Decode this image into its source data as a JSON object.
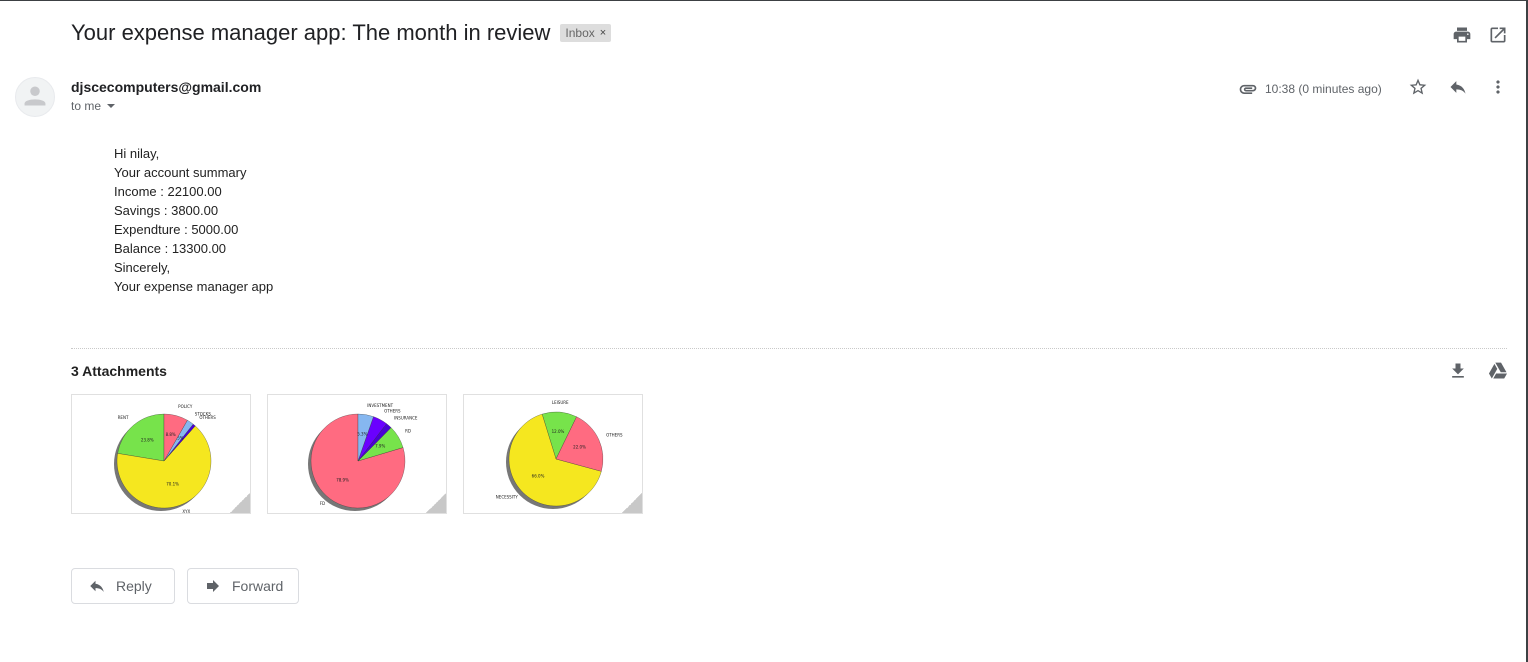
{
  "email": {
    "subject": "Your expense manager app: The month in review",
    "label": "Inbox",
    "label_remove": "×",
    "sender": "djscecomputers@gmail.com",
    "recipient_line": "to me",
    "time": "10:38 (0 minutes ago)",
    "body_lines": [
      "Hi nilay,",
      "Your account summary",
      "Income : 22100.00",
      "Savings : 3800.00",
      "Expendture : 5000.00",
      "Balance : 13300.00",
      "Sincerely,",
      "Your expense manager app"
    ]
  },
  "attachments": {
    "title": "3 Attachments",
    "items": [
      {
        "slices": [
          {
            "label": "RENT",
            "pct": "23.8%",
            "value": 23.8,
            "color": "#77e34b"
          },
          {
            "label": "XYX",
            "pct": "70.1%",
            "value": 70.1,
            "color": "#f5e71f"
          },
          {
            "label": "OTHERS",
            "pct": "",
            "value": 1.0,
            "color": "#4a00d6"
          },
          {
            "label": "STOCKS",
            "pct": "2.5%",
            "value": 2.5,
            "color": "#86b7f0"
          },
          {
            "label": "POLICY",
            "pct": "8.8%",
            "value": 8.8,
            "color": "#ff6b81"
          }
        ]
      },
      {
        "slices": [
          {
            "label": "FD",
            "pct": "78.9%",
            "value": 78.9,
            "color": "#ff6b81"
          },
          {
            "label": "RD",
            "pct": "7.9%",
            "value": 7.9,
            "color": "#77e34b"
          },
          {
            "label": "INSURANCE",
            "pct": "",
            "value": 2.0,
            "color": "#4a00d6"
          },
          {
            "label": "OTHERS",
            "pct": "",
            "value": 5.0,
            "color": "#6a00ff"
          },
          {
            "label": "INVESTMENT",
            "pct": "5.3%",
            "value": 5.3,
            "color": "#86b7f0"
          }
        ]
      },
      {
        "slices": [
          {
            "label": "LEISURE",
            "pct": "12.0%",
            "value": 12.0,
            "color": "#77e34b"
          },
          {
            "label": "NECESSITY",
            "pct": "66.0%",
            "value": 66.0,
            "color": "#f5e71f"
          },
          {
            "label": "OTHERS",
            "pct": "22.0%",
            "value": 22.0,
            "color": "#ff6b81"
          }
        ]
      }
    ]
  },
  "actions": {
    "reply": "Reply",
    "forward": "Forward"
  },
  "icons": {
    "print": "print-icon",
    "open_new_window": "open-in-new-icon",
    "attachment": "paperclip-icon",
    "star": "star-icon",
    "reply": "reply-icon",
    "more": "more-vert-icon",
    "download": "download-icon",
    "drive": "drive-icon",
    "avatar": "person-icon"
  }
}
